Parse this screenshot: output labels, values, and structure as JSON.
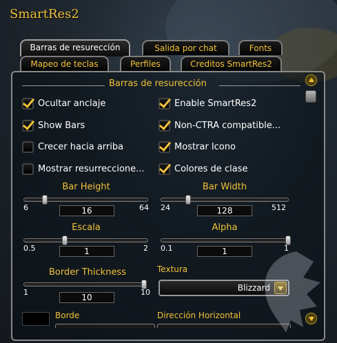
{
  "window": {
    "title": "SmartRes2"
  },
  "tabs": {
    "row1": [
      {
        "label": "Barras de resurección",
        "active": true
      },
      {
        "label": "Salida por chat",
        "active": false
      },
      {
        "label": "Fonts",
        "active": false
      }
    ],
    "row2": [
      {
        "label": "Mapeo de teclas",
        "active": false
      },
      {
        "label": "Perfiles",
        "active": false
      },
      {
        "label": "Creditos SmartRes2",
        "active": false
      }
    ]
  },
  "section": {
    "title": "Barras de resurección"
  },
  "checkboxes": [
    {
      "label": "Ocultar anclaje",
      "checked": true
    },
    {
      "label": "Enable SmartRes2",
      "checked": true
    },
    {
      "label": "Show Bars",
      "checked": true
    },
    {
      "label": "Non-CTRA compatible...",
      "checked": true
    },
    {
      "label": "Crecer hacia arriba",
      "checked": false
    },
    {
      "label": "Mostrar Icono",
      "checked": true
    },
    {
      "label": "Mostrar resurreccione...",
      "checked": false
    },
    {
      "label": "Colores de clase",
      "checked": true
    }
  ],
  "sliders": [
    {
      "label": "Bar Height",
      "min": "6",
      "max": "64",
      "value": "16",
      "fraction": 0.17
    },
    {
      "label": "Bar Width",
      "min": "24",
      "max": "512",
      "value": "128",
      "fraction": 0.21
    },
    {
      "label": "Escala",
      "min": "0.5",
      "max": "2",
      "value": "1",
      "fraction": 0.33
    },
    {
      "label": "Alpha",
      "min": "0.1",
      "max": "1",
      "value": "1",
      "fraction": 1.0
    },
    {
      "label": "Border Thickness",
      "min": "1",
      "max": "10",
      "value": "10",
      "fraction": 1.0
    }
  ],
  "texture": {
    "label": "Textura",
    "value": "Blizzard"
  },
  "border": {
    "label": "Borde",
    "color": "#000000"
  },
  "direction": {
    "label": "Dirección Horizontal"
  },
  "colors": {
    "accent": "#f1c23a"
  },
  "icons": {
    "scroll_up": "scroll-up-icon",
    "scroll_down": "scroll-down-icon",
    "dropdown": "chevron-down-icon"
  }
}
